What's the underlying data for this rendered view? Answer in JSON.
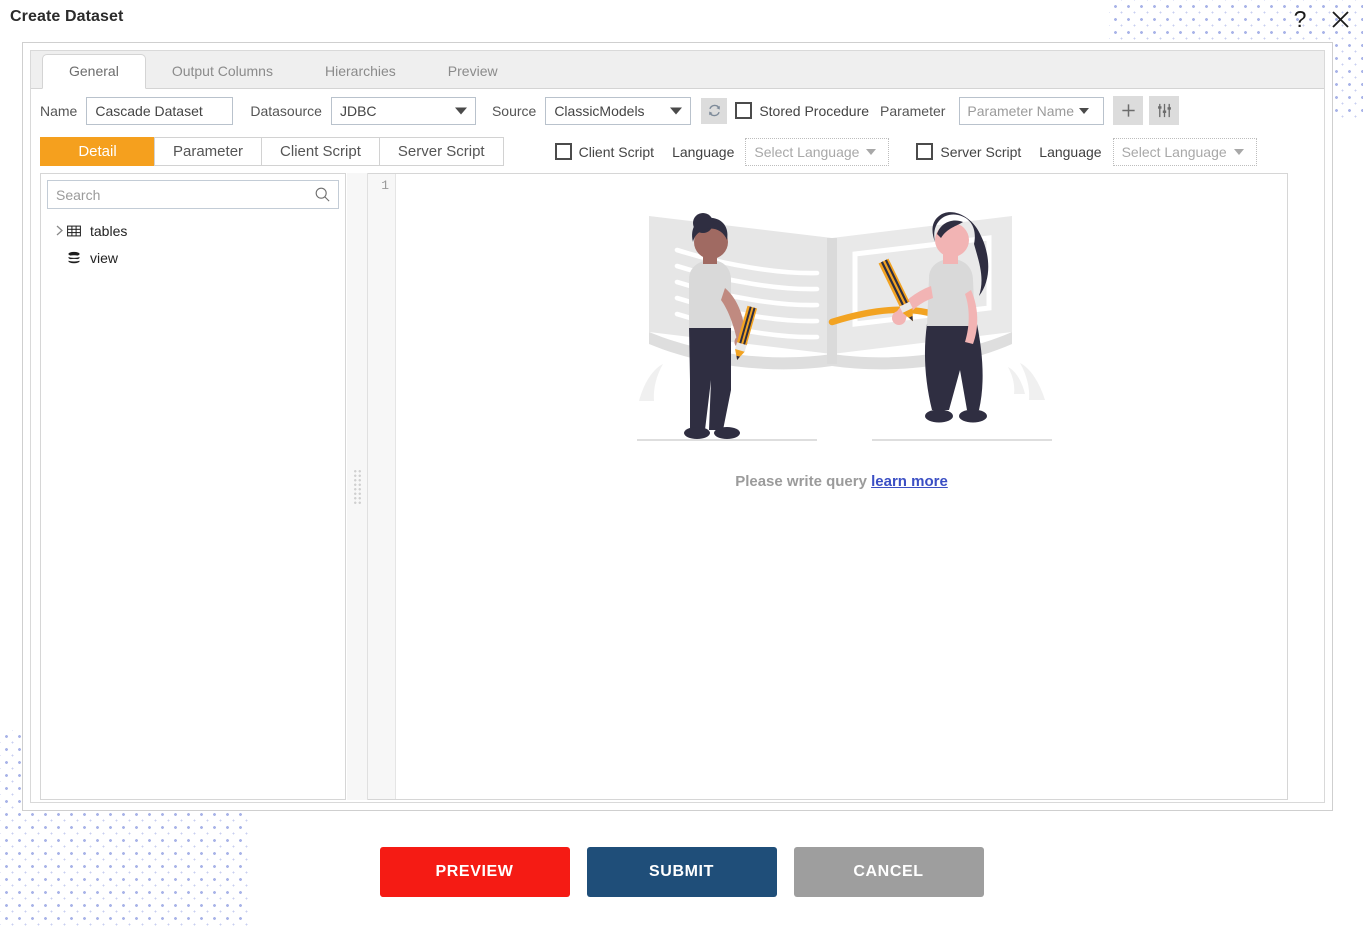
{
  "window": {
    "title": "Create Dataset",
    "help_icon": "question-mark-icon",
    "close_icon": "close-icon"
  },
  "main_tabs": [
    {
      "label": "General",
      "active": true
    },
    {
      "label": "Output Columns",
      "active": false
    },
    {
      "label": "Hierarchies",
      "active": false
    },
    {
      "label": "Preview",
      "active": false
    }
  ],
  "form": {
    "name_label": "Name",
    "name_value": "Cascade Dataset",
    "datasource_label": "Datasource",
    "datasource_value": "JDBC",
    "source_label": "Source",
    "source_value": "ClassicModels",
    "refresh_icon": "refresh-icon",
    "stored_procedure_label": "Stored Procedure",
    "stored_procedure_checked": false,
    "parameter_label": "Parameter",
    "parameter_name_placeholder": "Parameter Name",
    "add_icon": "plus-icon",
    "settings_icon": "sliders-icon"
  },
  "sub_tabs": [
    {
      "label": "Detail",
      "active": true
    },
    {
      "label": "Parameter",
      "active": false
    },
    {
      "label": "Client Script",
      "active": false
    },
    {
      "label": "Server Script",
      "active": false
    }
  ],
  "script_options": {
    "client_script_label": "Client Script",
    "client_script_checked": false,
    "client_language_label": "Language",
    "client_language_value": "Select Language",
    "server_script_label": "Server Script",
    "server_script_checked": false,
    "server_language_label": "Language",
    "server_language_value": "Select Language"
  },
  "tree": {
    "search_placeholder": "Search",
    "search_value": "",
    "search_icon": "search-icon",
    "items": [
      {
        "label": "tables",
        "icon": "table-grid-icon",
        "expandable": true,
        "chevron": "chevron-right-icon"
      },
      {
        "label": "view",
        "icon": "database-icon",
        "expandable": false,
        "chevron": ""
      }
    ]
  },
  "editor": {
    "line_numbers": [
      "1"
    ],
    "content": "",
    "empty_message": "Please write query",
    "learn_more_label": "learn more"
  },
  "footer": {
    "preview_label": "PREVIEW",
    "submit_label": "SUBMIT",
    "cancel_label": "CANCEL"
  },
  "colors": {
    "accent_orange": "#f5a01e",
    "preview_red": "#f51b14",
    "submit_blue": "#1f4e79",
    "cancel_gray": "#9e9e9e",
    "link_blue": "#3b4fc4",
    "dot_pattern": "#a9b4e8"
  }
}
